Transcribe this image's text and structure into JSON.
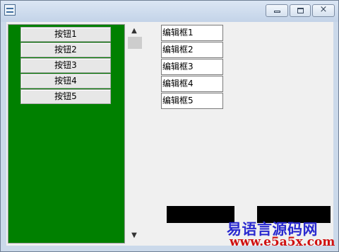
{
  "window": {
    "icon": "app-window-icon",
    "controls": {
      "minimize": "minimize-icon",
      "maximize": "maximize-icon",
      "close": "×"
    }
  },
  "panel": {
    "color": "#008000",
    "buttons": [
      {
        "label": "按钮1"
      },
      {
        "label": "按钮2"
      },
      {
        "label": "按钮3"
      },
      {
        "label": "按钮4"
      },
      {
        "label": "按钮5"
      }
    ]
  },
  "scrollbar": {
    "up": "▲",
    "down": "▼"
  },
  "edit_boxes": [
    {
      "value": "编辑框1"
    },
    {
      "value": "编辑框2"
    },
    {
      "value": "编辑框3"
    },
    {
      "value": "编辑框4"
    },
    {
      "value": "编辑框5"
    }
  ],
  "watermark": {
    "line1": "易语言源码网",
    "line2": "www.e5a5x.com"
  }
}
